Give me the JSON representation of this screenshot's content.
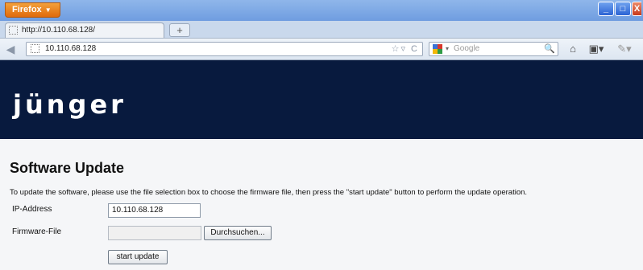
{
  "browser": {
    "app_button_label": "Firefox",
    "tab_title": "http://10.110.68.128/",
    "new_tab_symbol": "+",
    "url": "10.110.68.128",
    "search_placeholder": "Google"
  },
  "page": {
    "logo_text": "jünger",
    "heading": "Software Update",
    "description": "To update the software, please use the file selection box to choose the firmware file, then press the \"start update\" button to perform the update operation.",
    "ip_label": "IP-Address",
    "ip_value": "10.110.68.128",
    "firmware_label": "Firmware-File",
    "browse_label": "Durchsuchen...",
    "start_label": "start update"
  },
  "colors": {
    "banner": "#081a3e",
    "page_background": "#f5f6f8"
  }
}
